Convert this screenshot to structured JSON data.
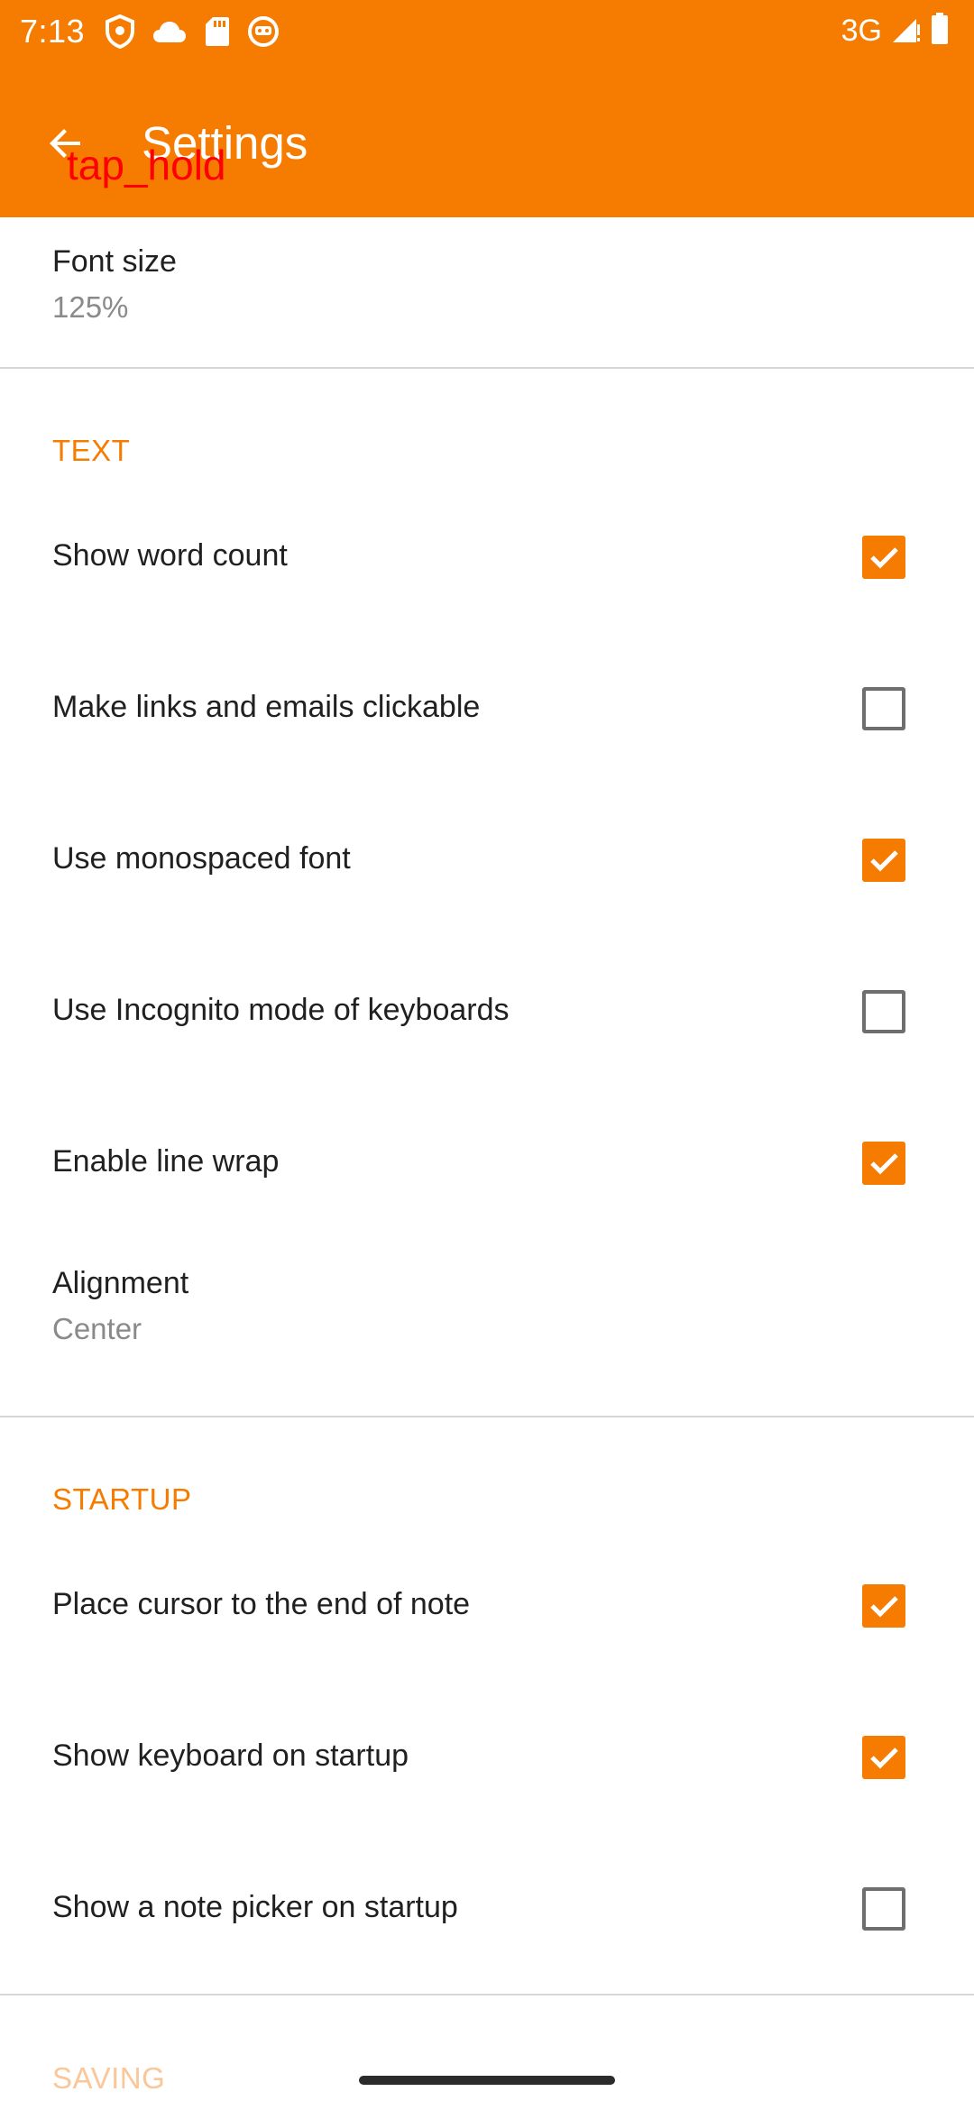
{
  "status_bar": {
    "time": "7:13",
    "network": "3G",
    "left_icons": [
      "shield-icon",
      "cloud-icon",
      "sd-card-icon",
      "robot-icon"
    ],
    "right_icons": [
      "signal-icon",
      "battery-icon"
    ]
  },
  "toolbar": {
    "title": "Settings",
    "back_icon": "arrow-back-icon",
    "background_color": "#F57C00"
  },
  "overlay": {
    "label": "tap_hold"
  },
  "preferences": {
    "font_size": {
      "title": "Font size",
      "summary": "125%"
    },
    "text_category": "TEXT",
    "show_word_count": {
      "title": "Show word count",
      "checked": true
    },
    "links_clickable": {
      "title": "Make links and emails clickable",
      "checked": false
    },
    "monospaced_font": {
      "title": "Use monospaced font",
      "checked": true
    },
    "incognito_keyboard": {
      "title": "Use Incognito mode of keyboards",
      "checked": false
    },
    "line_wrap": {
      "title": "Enable line wrap",
      "checked": true
    },
    "alignment": {
      "title": "Alignment",
      "summary": "Center"
    },
    "startup_category": "STARTUP",
    "cursor_end": {
      "title": "Place cursor to the end of note",
      "checked": true
    },
    "keyboard_startup": {
      "title": "Show keyboard on startup",
      "checked": true
    },
    "note_picker_startup": {
      "title": "Show a note picker on startup",
      "checked": false
    },
    "saving_category": "SAVING"
  },
  "colors": {
    "accent": "#F57C00",
    "checkbox_unchecked": "#6e6e6e"
  }
}
